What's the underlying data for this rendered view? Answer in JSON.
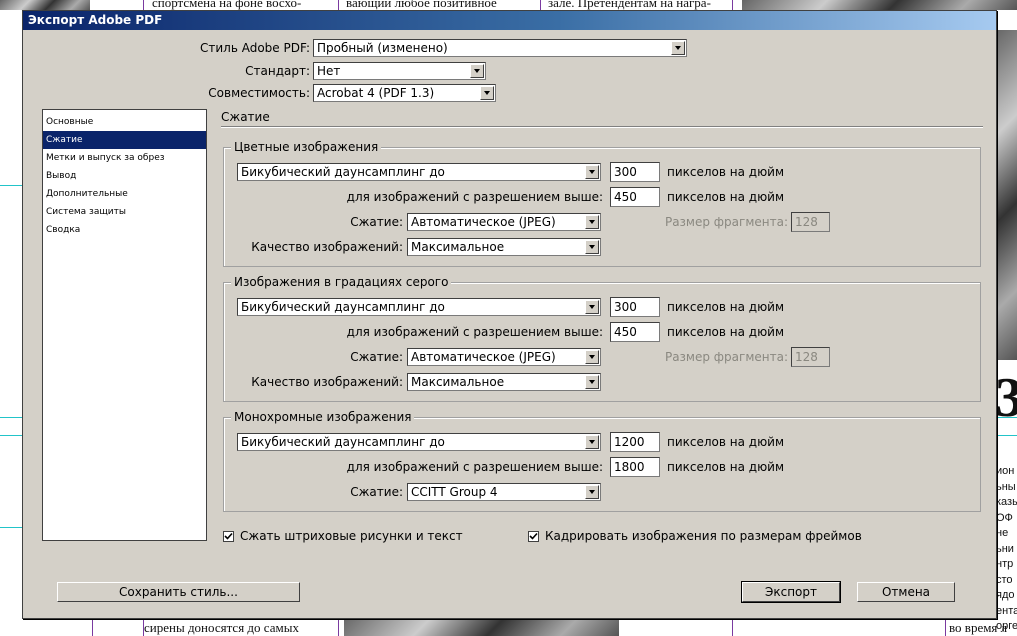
{
  "background": {
    "top_left": "спортсмена на фоне восхо-",
    "top_mid": "вающий любое позитивное",
    "top_right": "зале. Претендентам на награ-",
    "bottom_left": "сирены доносятся до самых",
    "bottom_right": "во время л",
    "big_letter": "3",
    "right_fragments": [
      "ион",
      "ьны",
      "казы",
      "ОФ",
      "не",
      "ьни",
      "нтр",
      "сто",
      "ядо",
      "ента",
      "орге"
    ]
  },
  "dialog": {
    "title": "Экспорт Adobe PDF",
    "top": {
      "style_label": "Стиль Adobe PDF:",
      "style_value": "Пробный (изменено)",
      "standard_label": "Стандарт:",
      "standard_value": "Нет",
      "compat_label": "Совместимость:",
      "compat_value": "Acrobat 4 (PDF 1.3)"
    },
    "sidebar": {
      "items": [
        {
          "label": "Основные",
          "active": false
        },
        {
          "label": "Сжатие",
          "active": true
        },
        {
          "label": "Метки и выпуск за обрез",
          "active": false
        },
        {
          "label": "Вывод",
          "active": false
        },
        {
          "label": "Дополнительные",
          "active": false
        },
        {
          "label": "Система защиты",
          "active": false
        },
        {
          "label": "Сводка",
          "active": false
        }
      ]
    },
    "section_title": "Сжатие",
    "color": {
      "title": "Цветные изображения",
      "downsample": "Бикубический даунсамплинг до",
      "ppi": "300",
      "ppi_unit": "пикселов на дюйм",
      "above_label": "для изображений с разрешением выше:",
      "above": "450",
      "above_unit": "пикселов на дюйм",
      "compression_label": "Сжатие:",
      "compression": "Автоматическое (JPEG)",
      "tile_label": "Размер фрагмента:",
      "tile": "128",
      "quality_label": "Качество изображений:",
      "quality": "Максимальное"
    },
    "gray": {
      "title": "Изображения в градациях серого",
      "downsample": "Бикубический даунсамплинг до",
      "ppi": "300",
      "ppi_unit": "пикселов на дюйм",
      "above_label": "для изображений с разрешением выше:",
      "above": "450",
      "above_unit": "пикселов на дюйм",
      "compression_label": "Сжатие:",
      "compression": "Автоматическое (JPEG)",
      "tile_label": "Размер фрагмента:",
      "tile": "128",
      "quality_label": "Качество изображений:",
      "quality": "Максимальное"
    },
    "mono": {
      "title": "Монохромные изображения",
      "downsample": "Бикубический даунсамплинг до",
      "ppi": "1200",
      "ppi_unit": "пикселов на дюйм",
      "above_label": "для изображений с разрешением выше:",
      "above": "1800",
      "above_unit": "пикселов на дюйм",
      "compression_label": "Сжатие:",
      "compression": "CCITT Group 4"
    },
    "checks": {
      "compress_text": "Сжать штриховые рисунки и текст",
      "crop_frames": "Кадрировать изображения по размерам фреймов"
    },
    "buttons": {
      "save_style": "Сохранить стиль...",
      "export": "Экспорт",
      "cancel": "Отмена"
    }
  }
}
